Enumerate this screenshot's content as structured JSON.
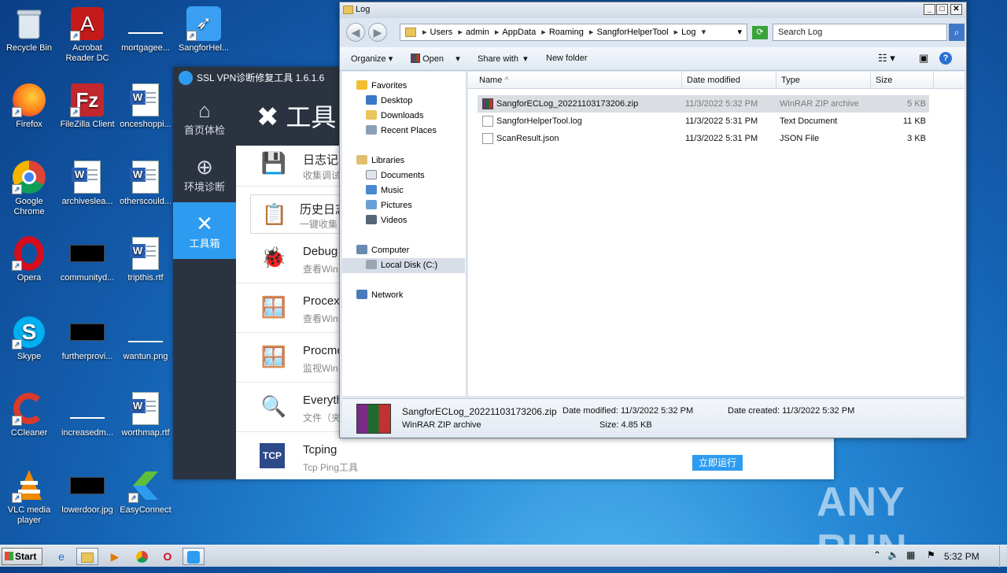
{
  "desktop": {
    "icons": [
      {
        "label": "Recycle Bin"
      },
      {
        "label": "Acrobat Reader DC"
      },
      {
        "label": "mortgagee..."
      },
      {
        "label": "SangforHel..."
      },
      {
        "label": "Firefox"
      },
      {
        "label": "FileZilla Client"
      },
      {
        "label": "onceshoppi..."
      },
      {
        "label": "Google Chrome"
      },
      {
        "label": "archiveslea..."
      },
      {
        "label": "otherscould..."
      },
      {
        "label": "Opera"
      },
      {
        "label": "communityd..."
      },
      {
        "label": "tripthis.rtf"
      },
      {
        "label": "Skype"
      },
      {
        "label": "furtherprovi..."
      },
      {
        "label": "wantun.png"
      },
      {
        "label": "CCleaner"
      },
      {
        "label": "increasedm..."
      },
      {
        "label": "worthmap.rtf"
      },
      {
        "label": "VLC media player"
      },
      {
        "label": "lowerdoor.jpg"
      },
      {
        "label": "EasyConnect"
      }
    ]
  },
  "sangfor": {
    "title": "SSL VPN诊断修复工具 1.6.1.6",
    "header": "工具",
    "nav": [
      {
        "label": "首页体检",
        "glyph": "⌂"
      },
      {
        "label": "环境诊断",
        "glyph": "⊕"
      },
      {
        "label": "工具箱",
        "glyph": "✕"
      }
    ],
    "tools": [
      {
        "title": "日志记",
        "desc": "收集调试",
        "icon": "💾"
      },
      {
        "title": "历史日志",
        "desc": "一键收集",
        "icon": "📋"
      },
      {
        "title": "Debug",
        "desc": "查看Win",
        "icon": "🐞"
      },
      {
        "title": "Procex",
        "desc": "查看Win",
        "icon": "🪟"
      },
      {
        "title": "Procmo",
        "desc": "监视Win",
        "icon": "🪟"
      },
      {
        "title": "Everyth",
        "desc": "文件（夹",
        "icon": "🔍"
      },
      {
        "title": "Tcping",
        "desc": "Tcp Ping工具",
        "icon": "TCP"
      }
    ],
    "run_button": "立即运行"
  },
  "explorer": {
    "title": "Log",
    "breadcrumb": [
      "Users",
      "admin",
      "AppData",
      "Roaming",
      "SangforHelperTool",
      "Log"
    ],
    "search_placeholder": "Search Log",
    "toolbar": {
      "organize": "Organize",
      "open": "Open",
      "share": "Share with",
      "new_folder": "New folder"
    },
    "nav": {
      "favorites": "Favorites",
      "desktop": "Desktop",
      "downloads": "Downloads",
      "recent": "Recent Places",
      "libraries": "Libraries",
      "documents": "Documents",
      "music": "Music",
      "pictures": "Pictures",
      "videos": "Videos",
      "computer": "Computer",
      "local_disk": "Local Disk (C:)",
      "network": "Network"
    },
    "columns": {
      "name": "Name",
      "date": "Date modified",
      "type": "Type",
      "size": "Size"
    },
    "files": [
      {
        "name": "SangforECLog_20221103173206.zip",
        "date": "11/3/2022 5:32 PM",
        "type": "WinRAR ZIP archive",
        "size": "5 KB"
      },
      {
        "name": "SangforHelperTool.log",
        "date": "11/3/2022 5:31 PM",
        "type": "Text Document",
        "size": "11 KB"
      },
      {
        "name": "ScanResult.json",
        "date": "11/3/2022 5:31 PM",
        "type": "JSON File",
        "size": "3 KB"
      }
    ],
    "details": {
      "name": "SangforECLog_20221103173206.zip",
      "type": "WinRAR ZIP archive",
      "modified": "Date modified: 11/3/2022 5:32 PM",
      "created": "Date created: 11/3/2022 5:32 PM",
      "size": "Size: 4.85 KB"
    }
  },
  "taskbar": {
    "start": "Start",
    "clock": "5:32 PM"
  },
  "watermark": "ANY RUN"
}
